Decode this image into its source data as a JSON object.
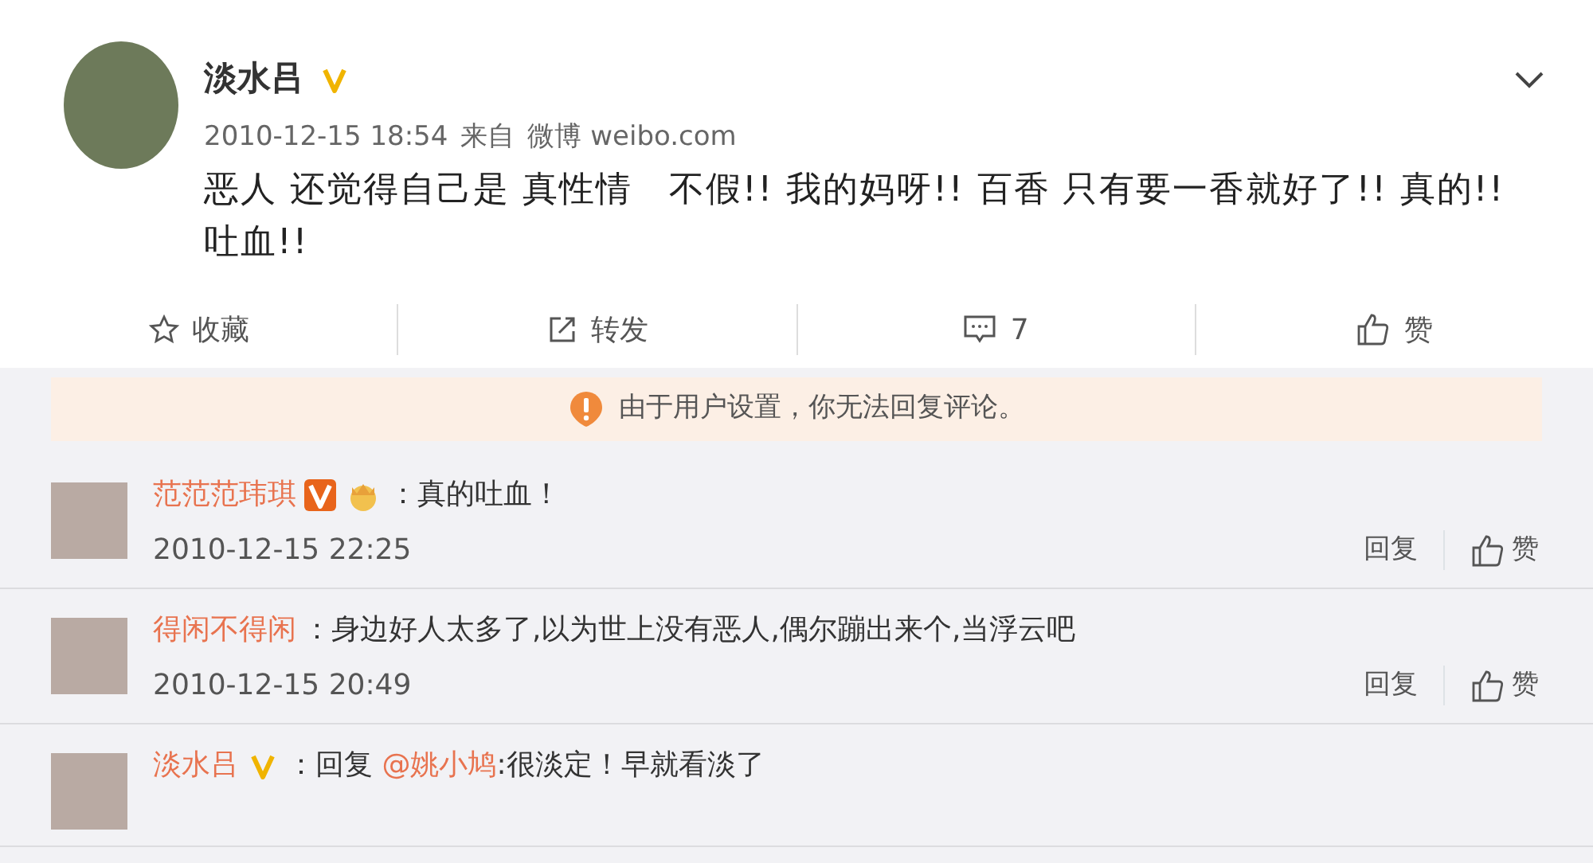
{
  "post": {
    "author": "淡水吕",
    "verified": true,
    "badge_filled": false,
    "color": "#f0b400",
    "time": "2010-12-15 18:54",
    "source_prefix": "来自",
    "source": "微博 weibo.com",
    "text": "恶人 还觉得自己是 真性情　不假!! 我的妈呀!!  百香  只有要一香就好了!! 真的!! 吐血!!",
    "actions": [
      {
        "kind": "star",
        "label": "收藏"
      },
      {
        "kind": "repost",
        "label": "转发"
      },
      {
        "kind": "comment",
        "label": "7"
      },
      {
        "kind": "like",
        "label": "赞"
      }
    ]
  },
  "notice": "由于用户设置，你无法回复评论。",
  "comments": [
    {
      "author": "范范范玮琪",
      "verified": true,
      "badge_filled": true,
      "color": "#e8641b",
      "vip": true,
      "text": "：真的吐血！",
      "time": "2010-12-15 22:25",
      "reply": "回复",
      "like": "赞"
    },
    {
      "author": "得闲不得闲",
      "verified": false,
      "vip": false,
      "text": "：身边好人太多了,以为世上没有恶人,偶尔蹦出来个,当浮云吧",
      "time": "2010-12-15 20:49",
      "reply": "回复",
      "like": "赞"
    },
    {
      "author": "淡水吕",
      "verified": true,
      "badge_filled": false,
      "color": "#f0b400",
      "vip": false,
      "text": "：回复 ",
      "mention": "@姚小鸠",
      "text_after": ":很淡定！早就看淡了"
    }
  ]
}
